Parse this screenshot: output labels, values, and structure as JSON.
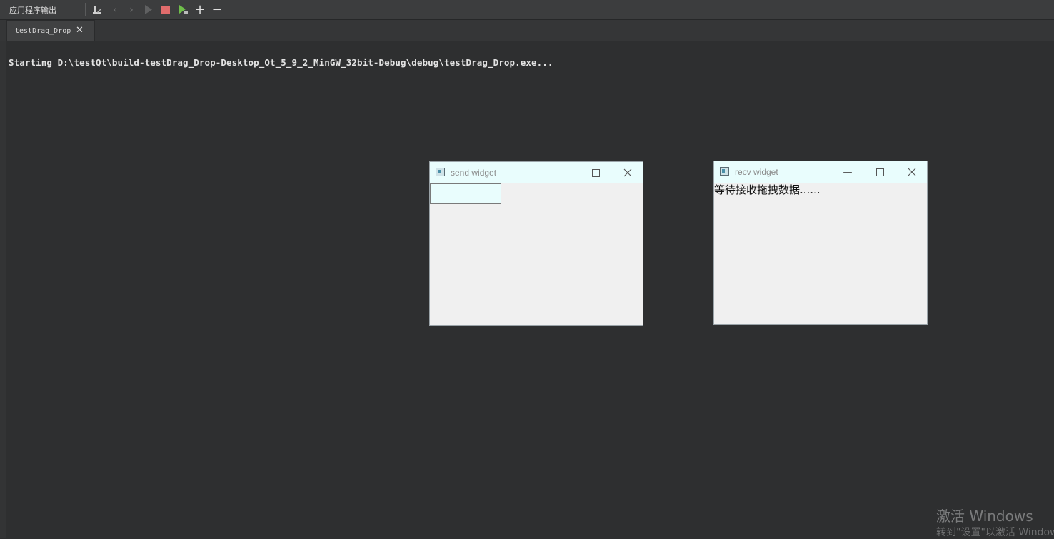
{
  "panel": {
    "title": "应用程序输出",
    "icons": [
      "clean-icon",
      "prev-icon",
      "next-icon",
      "run-icon",
      "stop-icon",
      "debug-run-icon",
      "zoom-in-icon",
      "zoom-out-icon"
    ]
  },
  "tabs": [
    {
      "label": "testDrag_Drop",
      "close_icon": "close-icon"
    }
  ],
  "output": {
    "line": "Starting D:\\testQt\\build-testDrag_Drop-Desktop_Qt_5_9_2_MinGW_32bit-Debug\\debug\\testDrag_Drop.exe..."
  },
  "send_window": {
    "title": "send widget",
    "input_value": ""
  },
  "recv_window": {
    "title": "recv widget",
    "label": "等待接收拖拽数据......"
  },
  "watermark": {
    "line1": "激活 Windows",
    "line2": "转到\"设置\"以激活 Windows。"
  },
  "colors": {
    "background": "#2e2f30",
    "stop": "#e06c6c",
    "run_disabled": "#5f6061",
    "debug": "#6fbf4a",
    "titlebar": "#e9fdfd"
  }
}
